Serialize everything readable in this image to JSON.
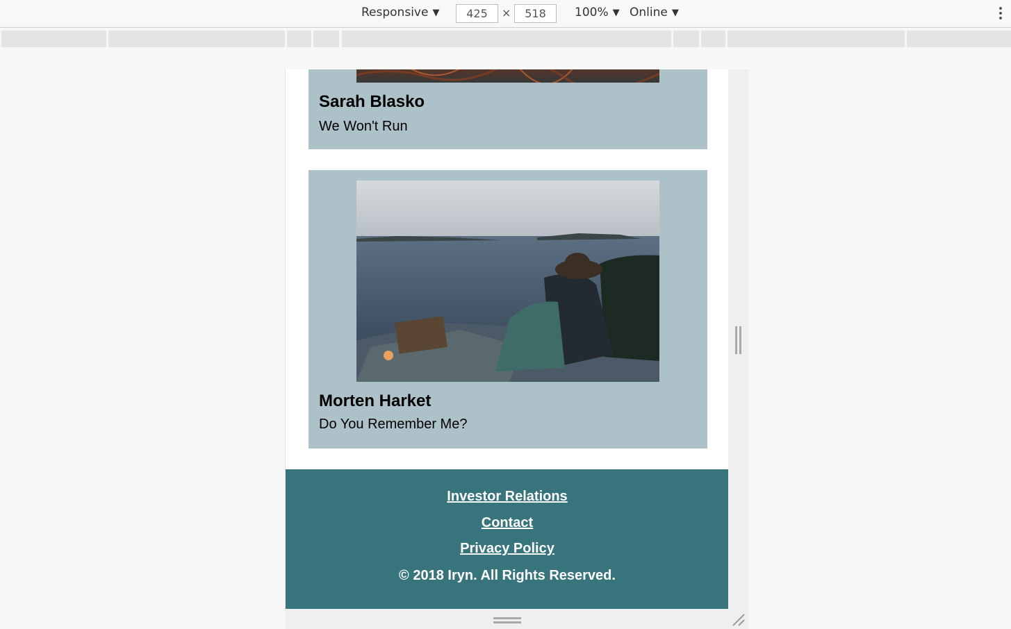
{
  "devtools": {
    "device_mode": "Responsive",
    "width": "425",
    "height": "518",
    "times_sign": "×",
    "zoom": "100%",
    "throttling": "Online",
    "caret": "▼"
  },
  "cards": [
    {
      "artist": "Sarah Blasko",
      "song": "We Won't Run",
      "image_icon": "album-image-icon"
    },
    {
      "artist": "Morten Harket",
      "song": "Do You Remember Me?",
      "image_icon": "album-image-icon"
    }
  ],
  "footer": {
    "links": [
      "Investor Relations",
      "Contact",
      "Privacy Policy"
    ],
    "copyright": "© 2018 Iryn. All Rights Reserved."
  },
  "colors": {
    "card_bg": "#adc1c9",
    "footer_bg": "#37747c",
    "page_bg": "#ffffff"
  }
}
